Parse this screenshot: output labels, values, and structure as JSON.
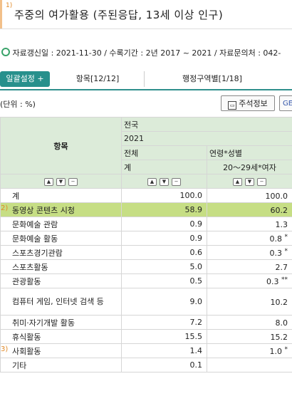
{
  "header": {
    "superscript": "1)",
    "title": "주중의 여가활용 (주된응답, 13세 이상 인구)"
  },
  "meta": {
    "text": "자료갱신일 : 2021-11-30 / 수록기간 : 2년 2017 ~ 2021 / 자료문의처 : 042-"
  },
  "tabs": {
    "settings_button": "일괄설정 +",
    "items_tab": "항목[12/12]",
    "region_tab": "행정구역별[1/18]"
  },
  "unit_label": "(단위 : %)",
  "buttons": {
    "note": "주석정보",
    "share": "GE"
  },
  "table": {
    "corner_label": "항목",
    "header_rows": [
      {
        "col1": "전국",
        "col2": ""
      },
      {
        "col1": "2021",
        "col2": ""
      },
      {
        "col1": "전체",
        "col2": "연령*성별"
      },
      {
        "col1": "계",
        "col2": "20～29세*여자"
      }
    ],
    "rows": [
      {
        "marker": "",
        "label": "계",
        "v1": "100.0",
        "v2": "100.0",
        "note": ""
      },
      {
        "marker": "2)",
        "label": "동영상 콘텐츠 시청",
        "v1": "58.9",
        "v2": "60.2",
        "note": ""
      },
      {
        "marker": "",
        "label": "문화예술 관람",
        "v1": "0.9",
        "v2": "1.3",
        "note": ""
      },
      {
        "marker": "",
        "label": "문화예술 활동",
        "v1": "0.9",
        "v2": "0.8",
        "note": "*"
      },
      {
        "marker": "",
        "label": "스포츠경기관람",
        "v1": "0.6",
        "v2": "0.3",
        "note": "*"
      },
      {
        "marker": "",
        "label": "스포츠활동",
        "v1": "5.0",
        "v2": "2.7",
        "note": ""
      },
      {
        "marker": "",
        "label": "관광활동",
        "v1": "0.5",
        "v2": "0.3",
        "note": "**"
      },
      {
        "marker": "",
        "label": "컴퓨터 게임, 인터넷 검색 등",
        "v1": "9.0",
        "v2": "10.2",
        "note": ""
      },
      {
        "marker": "",
        "label": "취미·자기개발 활동",
        "v1": "7.2",
        "v2": "8.0",
        "note": ""
      },
      {
        "marker": "",
        "label": "휴식활동",
        "v1": "15.5",
        "v2": "15.2",
        "note": ""
      },
      {
        "marker": "3)",
        "label": "사회활동",
        "v1": "1.4",
        "v2": "1.0",
        "note": "*"
      },
      {
        "marker": "",
        "label": "기타",
        "v1": "0.1",
        "v2": "",
        "note": ""
      }
    ]
  }
}
